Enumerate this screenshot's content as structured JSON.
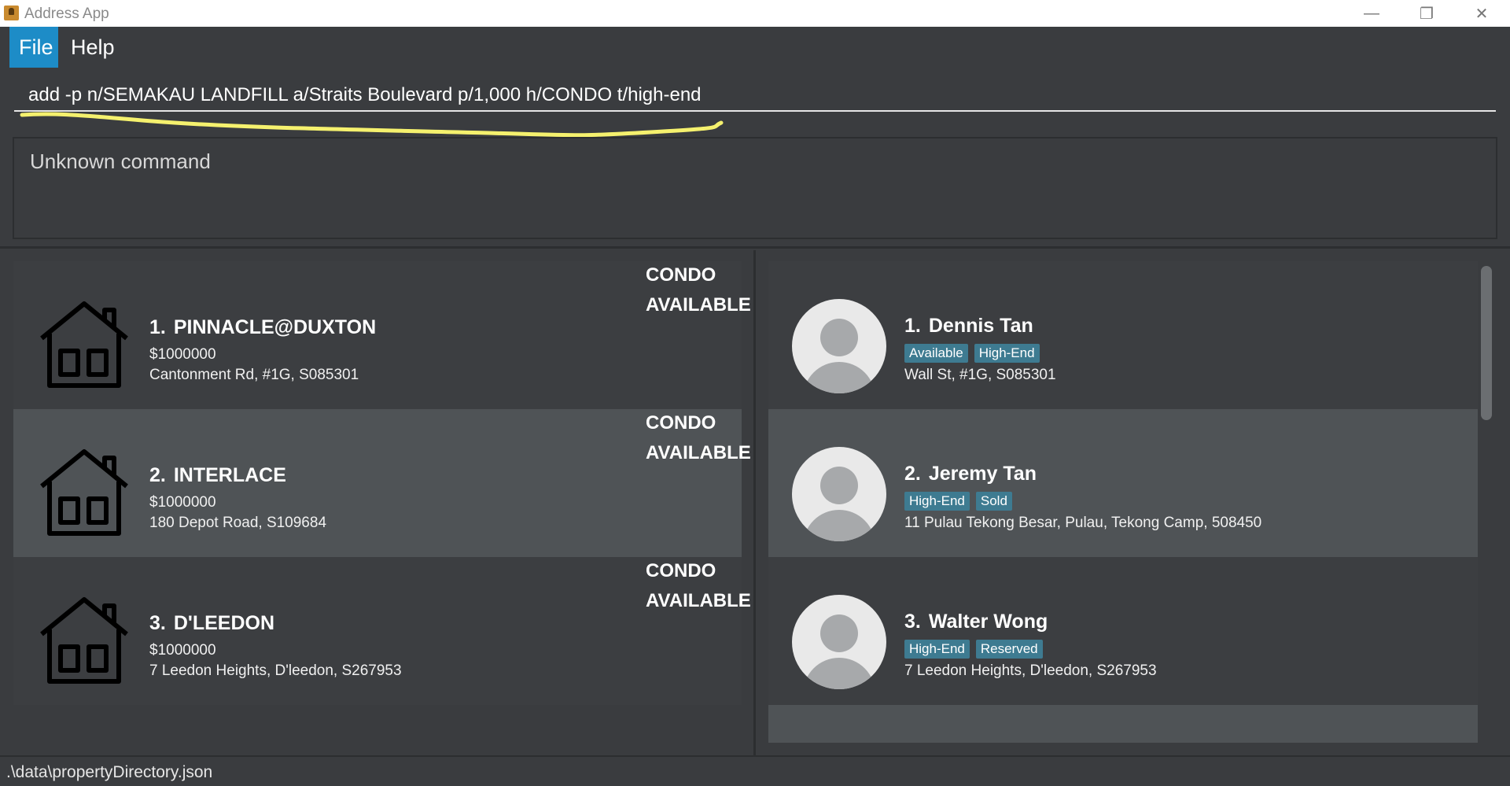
{
  "window": {
    "title": "Address App",
    "controls": {
      "minimize": "—",
      "maximize": "❐",
      "close": "✕"
    }
  },
  "menu": {
    "items": [
      "File",
      "Help"
    ]
  },
  "command": {
    "value": "add -p n/SEMAKAU LANDFILL a/Straits Boulevard p/1,000 h/CONDO t/high-end",
    "highlight_color": "#f5f16e"
  },
  "result": {
    "text": "Unknown command"
  },
  "properties": [
    {
      "index": "1.",
      "name": "PINNACLE@DUXTON",
      "price": "$1000000",
      "address": "Cantonment Rd, #1G, S085301",
      "type": "CONDO",
      "status": "AVAILABLE",
      "icon": "house-icon"
    },
    {
      "index": "2.",
      "name": "INTERLACE",
      "price": "$1000000",
      "address": "180 Depot Road, S109684",
      "type": "CONDO",
      "status": "AVAILABLE",
      "icon": "house-icon"
    },
    {
      "index": "3.",
      "name": "D'LEEDON",
      "price": "$1000000",
      "address": "7 Leedon Heights, D'leedon, S267953",
      "type": "CONDO",
      "status": "AVAILABLE",
      "icon": "house-icon"
    }
  ],
  "clients": [
    {
      "index": "1.",
      "name": "Dennis Tan",
      "tags": [
        "Available",
        "High-End"
      ],
      "address": "Wall St, #1G, S085301",
      "icon": "avatar-icon"
    },
    {
      "index": "2.",
      "name": "Jeremy Tan",
      "tags": [
        "High-End",
        "Sold"
      ],
      "address": "11 Pulau Tekong Besar, Pulau, Tekong Camp, 508450",
      "icon": "avatar-icon"
    },
    {
      "index": "3.",
      "name": "Walter Wong",
      "tags": [
        "High-End",
        "Reserved"
      ],
      "address": "7 Leedon Heights, D'leedon, S267953",
      "icon": "avatar-icon"
    }
  ],
  "status": {
    "path": ".\\data\\propertyDirectory.json"
  },
  "colors": {
    "accent": "#1d8cc7",
    "tag": "#3e7b91",
    "background": "#3a3c3f",
    "card_selected": "#4f5356"
  }
}
